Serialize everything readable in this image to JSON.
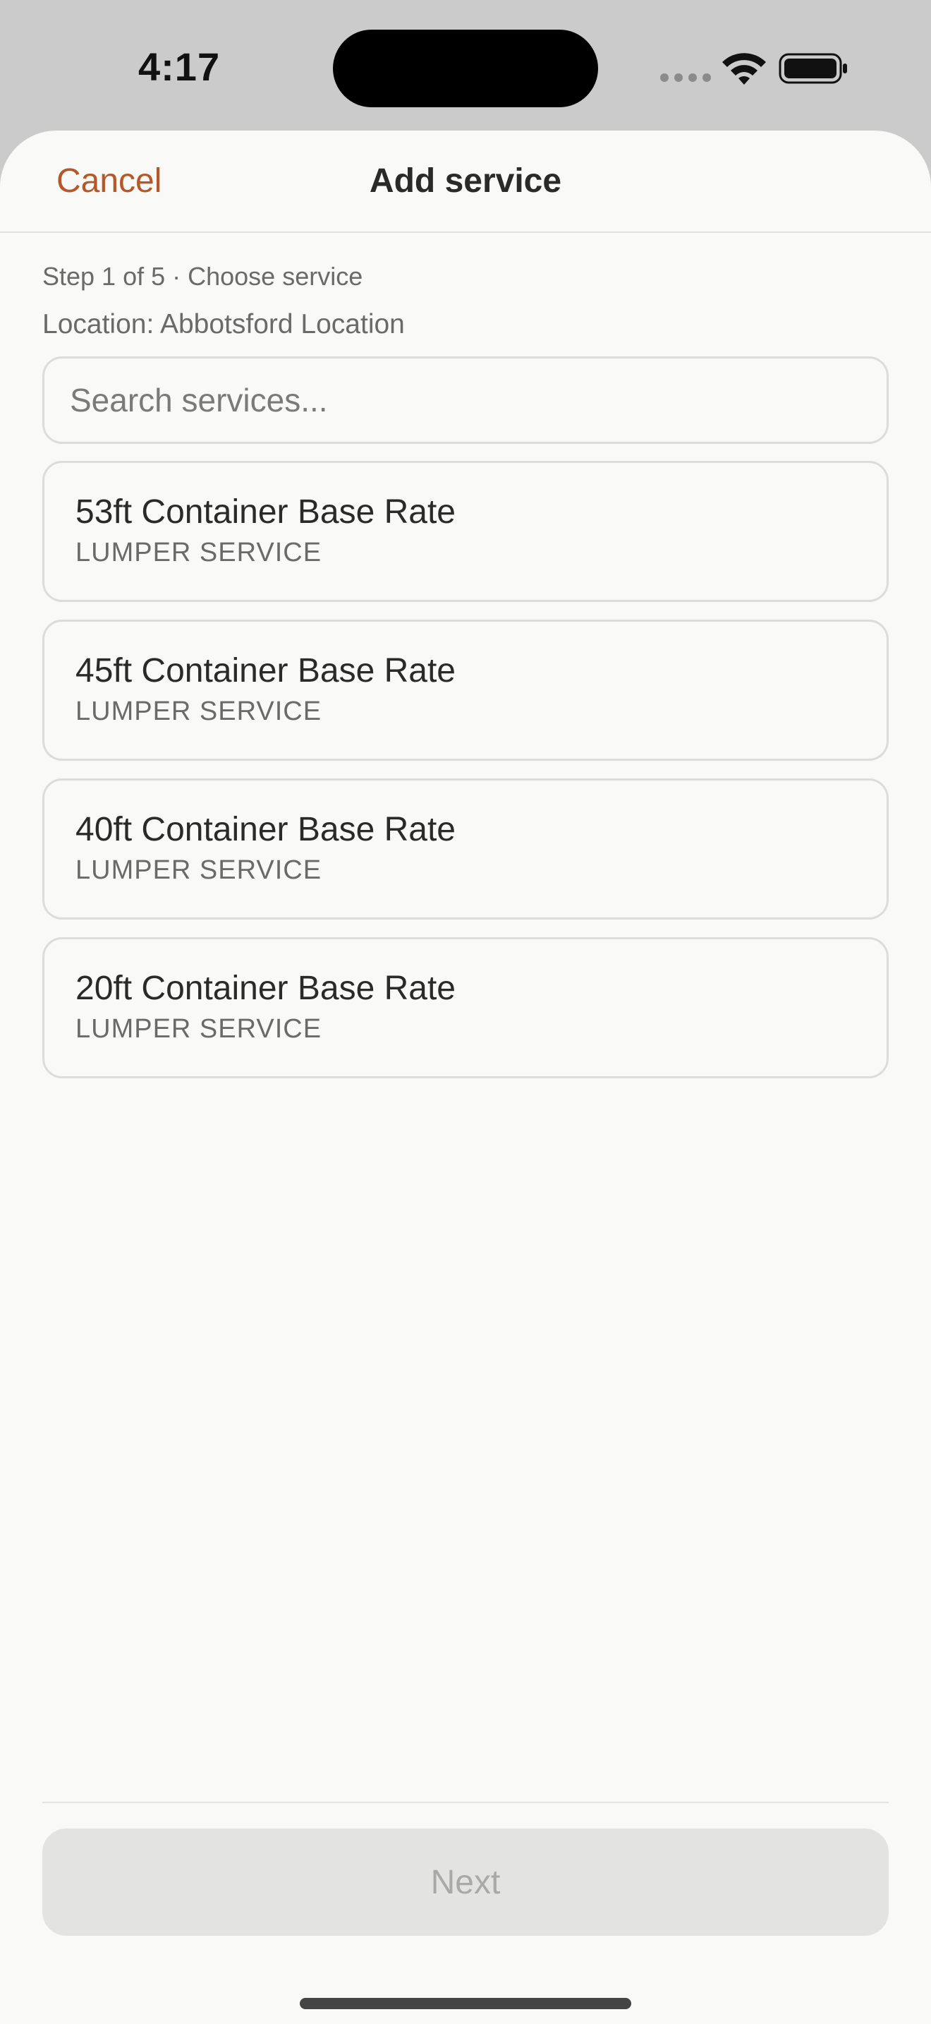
{
  "status_bar": {
    "time": "4:17",
    "icons": [
      "signal-dots-icon",
      "wifi-icon",
      "battery-icon"
    ]
  },
  "sheet": {
    "cancel_label": "Cancel",
    "title": "Add service",
    "step_label": "Step 1 of 5 · Choose service",
    "location_label": "Location: Abbotsford Location",
    "search": {
      "placeholder": "Search services...",
      "value": ""
    },
    "services": [
      {
        "name": "53ft Container Base Rate",
        "category": "LUMPER SERVICE"
      },
      {
        "name": "45ft Container Base Rate",
        "category": "LUMPER SERVICE"
      },
      {
        "name": "40ft Container Base Rate",
        "category": "LUMPER SERVICE"
      },
      {
        "name": "20ft Container Base Rate",
        "category": "LUMPER SERVICE"
      }
    ],
    "next_label": "Next"
  },
  "colors": {
    "accent": "#b4582a",
    "background": "#f9f9f7",
    "disabled_button": "#e3e3e2"
  }
}
